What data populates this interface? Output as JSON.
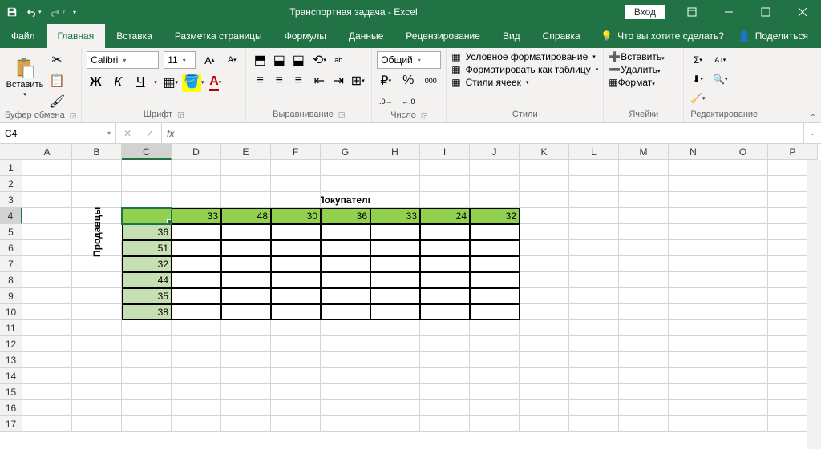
{
  "titlebar": {
    "title": "Транспортная задача  -  Excel",
    "signin": "Вход"
  },
  "tabs": {
    "file": "Файл",
    "home": "Главная",
    "insert": "Вставка",
    "layout": "Разметка страницы",
    "formulas": "Формулы",
    "data": "Данные",
    "review": "Рецензирование",
    "view": "Вид",
    "help": "Справка",
    "tell_me": "Что вы хотите сделать?",
    "share": "Поделиться"
  },
  "ribbon": {
    "clipboard": {
      "paste": "Вставить",
      "label": "Буфер обмена"
    },
    "font": {
      "name": "Calibri",
      "size": "11",
      "label": "Шрифт",
      "bold": "Ж",
      "italic": "К",
      "underline": "Ч"
    },
    "alignment": {
      "label": "Выравнивание"
    },
    "number": {
      "format": "Общий",
      "label": "Число"
    },
    "styles": {
      "cond": "Условное форматирование",
      "table": "Форматировать как таблицу",
      "cell": "Стили ячеек",
      "label": "Стили"
    },
    "cells": {
      "insert": "Вставить",
      "delete": "Удалить",
      "format": "Формат",
      "label": "Ячейки"
    },
    "editing": {
      "label": "Редактирование"
    }
  },
  "formula_bar": {
    "namebox": "C4",
    "fx": "fx"
  },
  "grid": {
    "columns": [
      "A",
      "B",
      "C",
      "D",
      "E",
      "F",
      "G",
      "H",
      "I",
      "J",
      "K",
      "L",
      "M",
      "N",
      "O",
      "P"
    ],
    "rows": [
      "1",
      "2",
      "3",
      "4",
      "5",
      "6",
      "7",
      "8",
      "9",
      "10",
      "11",
      "12",
      "13",
      "14",
      "15",
      "16",
      "17"
    ],
    "active_col": "C",
    "active_row": "4",
    "buyers_label": "Покупатели",
    "sellers_label": "Продавцы",
    "buyers": [
      "33",
      "48",
      "30",
      "36",
      "33",
      "24",
      "32"
    ],
    "sellers": [
      "36",
      "51",
      "32",
      "44",
      "35",
      "38"
    ]
  },
  "chart_data": {
    "type": "table",
    "title": "Транспортная задача",
    "columns_label": "Покупатели",
    "rows_label": "Продавцы",
    "column_headers": [
      33,
      48,
      30,
      36,
      33,
      24,
      32
    ],
    "row_headers": [
      36,
      51,
      32,
      44,
      35,
      38
    ],
    "matrix": [
      [
        null,
        null,
        null,
        null,
        null,
        null,
        null
      ],
      [
        null,
        null,
        null,
        null,
        null,
        null,
        null
      ],
      [
        null,
        null,
        null,
        null,
        null,
        null,
        null
      ],
      [
        null,
        null,
        null,
        null,
        null,
        null,
        null
      ],
      [
        null,
        null,
        null,
        null,
        null,
        null,
        null
      ],
      [
        null,
        null,
        null,
        null,
        null,
        null,
        null
      ]
    ]
  }
}
